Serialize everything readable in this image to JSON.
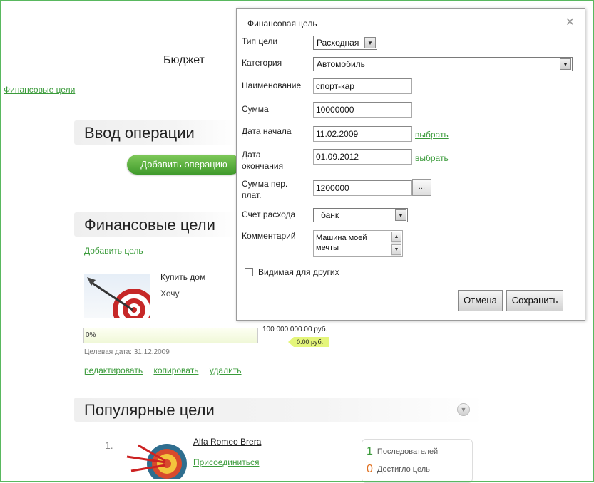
{
  "page": {
    "title": "Бюджет",
    "breadcrumb": "Финансовые цели"
  },
  "operation_section": {
    "title": "Ввод операции",
    "add_button": "Добавить операцию"
  },
  "goals_section": {
    "title": "Финансовые цели",
    "add_goal": "Добавить цель",
    "goal": {
      "name": "Купить дом",
      "description": "Хочу",
      "progress_text": "0%",
      "progress_fraction": 0,
      "target_amount": "100 000 000.00 руб.",
      "saved_amount": "0.00 руб.",
      "target_date": "Целевая дата: 31.12.2009",
      "actions": {
        "edit": "редактировать",
        "copy": "копировать",
        "delete": "удалить"
      }
    }
  },
  "popular_section": {
    "title": "Популярные цели",
    "item": {
      "number": "1.",
      "name": "Alfa Romeo Brera",
      "join": "Присоединиться",
      "followers_count": "1",
      "followers_label": "Последователей",
      "achieved_count": "0",
      "achieved_label": "Достигло цель"
    }
  },
  "dialog": {
    "title": "Финансовая цель",
    "close": "✕",
    "type_label": "Тип цели",
    "type_value": "Расходная",
    "category_label": "Категория",
    "category_value": "Автомобиль",
    "name_label": "Наименование",
    "name_value": "спорт-кар",
    "amount_label": "Сумма",
    "amount_value": "10000000",
    "start_label": "Дата начала",
    "start_value": "11.02.2009",
    "end_label_1": "Дата",
    "end_label_2": "окончания",
    "end_value": "01.09.2012",
    "pick": "выбрать",
    "per_payment_label_1": "Сумма пер.",
    "per_payment_label_2": "плат.",
    "per_payment_value": "1200000",
    "dots": "...",
    "account_label": "Счет расхода",
    "account_value": "банк",
    "comment_label": "Комментарий",
    "comment_value": "Машина моей мечты",
    "visible_label": "Видимая для других",
    "visible_checked": false,
    "cancel": "Отмена",
    "save": "Сохранить"
  },
  "colors": {
    "link": "#3b9b3b",
    "button_green": "#4ea737",
    "frame": "#59b85f",
    "saved_badge": "#e4f57a"
  }
}
